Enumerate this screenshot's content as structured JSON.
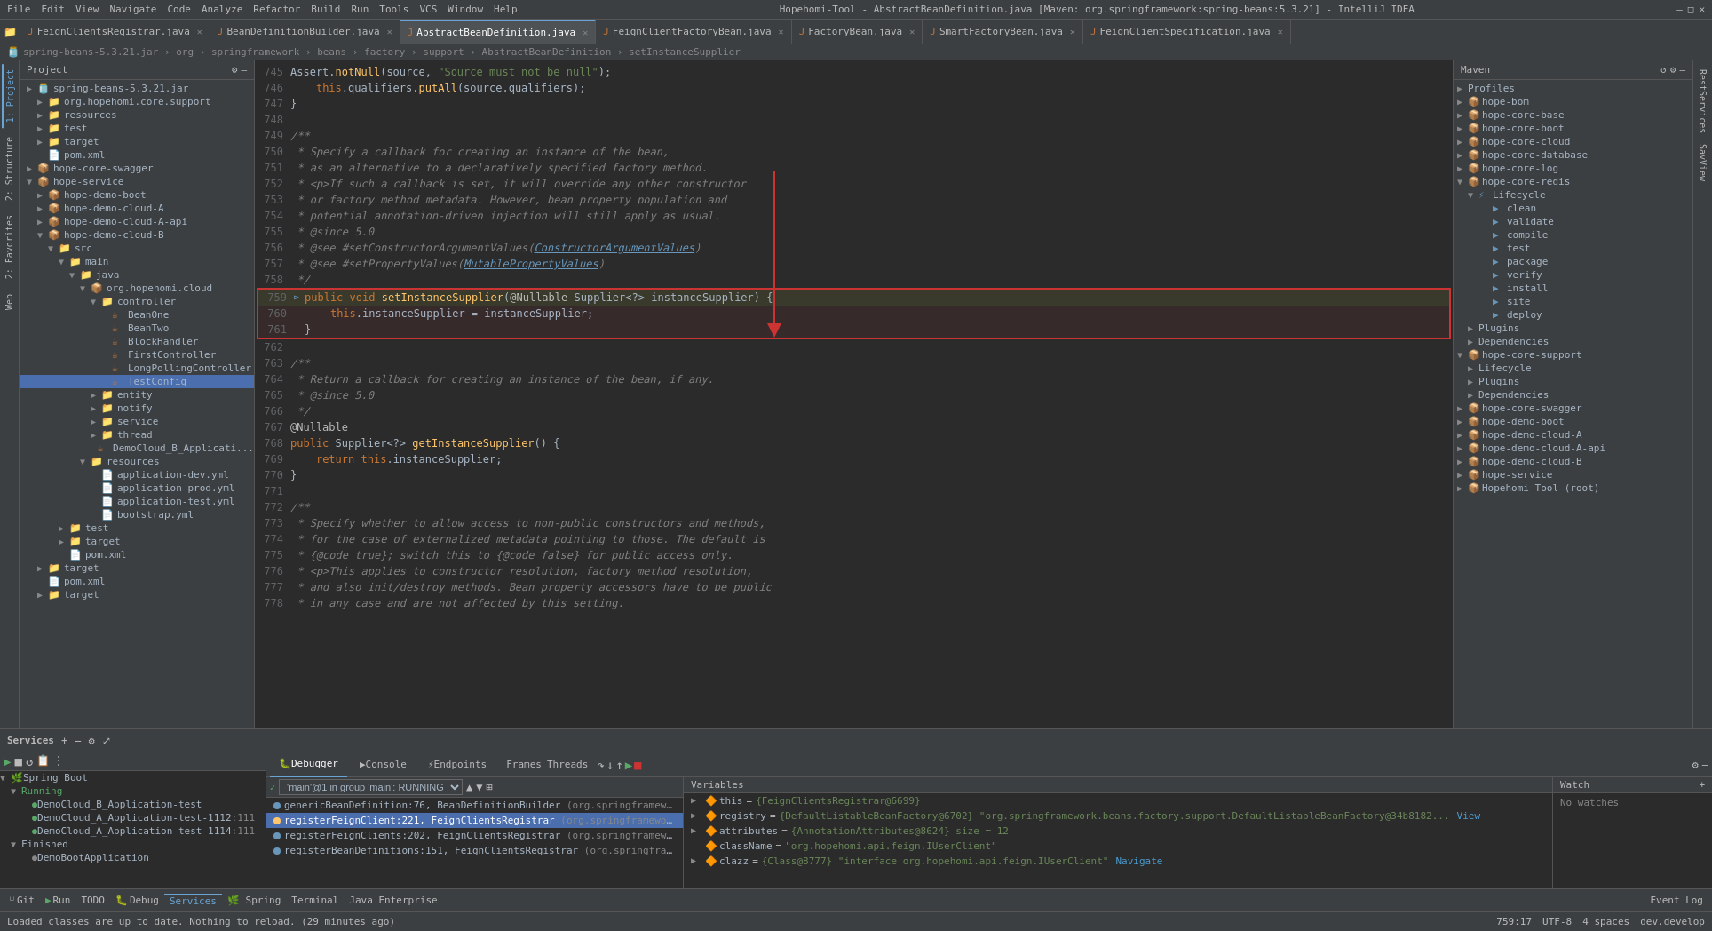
{
  "titlebar": {
    "menu": [
      "File",
      "Edit",
      "View",
      "Navigate",
      "Code",
      "Analyze",
      "Refactor",
      "Build",
      "Run",
      "Tools",
      "VCS",
      "Window",
      "Help"
    ],
    "title": "Hopehomi-Tool - AbstractBeanDefinition.java [Maven: org.springframework:spring-beans:5.3.21] - IntelliJ IDEA",
    "controls": [
      "—",
      "□",
      "✕"
    ]
  },
  "breadcrumb_path": "spring-beans-5.3.21.jar  ›  org  ›  springframework  ›  beans  ›  factory  ›  support  ›  AbstractBeanDefinition  ›  setInstanceSupplier",
  "tabs": [
    {
      "label": "FeignClientsRegistrar.java",
      "active": false,
      "icon": "J"
    },
    {
      "label": "BeanDefinitionBuilder.java",
      "active": false,
      "icon": "J"
    },
    {
      "label": "AbstractBeanDefinition.java",
      "active": true,
      "icon": "J"
    },
    {
      "label": "FeignClientFactoryBean.java",
      "active": false,
      "icon": "J"
    },
    {
      "label": "FactoryBean.java",
      "active": false,
      "icon": "J"
    },
    {
      "label": "SmartFactoryBean.java",
      "active": false,
      "icon": "J"
    },
    {
      "label": "FeignClientSpecification.java",
      "active": false,
      "icon": "J"
    }
  ],
  "code_lines": [
    {
      "num": "745",
      "content": "Assert.notNull(source, \"Source must not be null\");",
      "type": "normal"
    },
    {
      "num": "746",
      "content": "    this.qualifiers.putAll(source.qualifiers);",
      "type": "normal"
    },
    {
      "num": "747",
      "content": "}",
      "type": "normal"
    },
    {
      "num": "748",
      "content": "",
      "type": "normal"
    },
    {
      "num": "749",
      "content": "/**",
      "type": "comment"
    },
    {
      "num": "750",
      "content": " * Specify a callback for creating an instance of the bean,",
      "type": "comment"
    },
    {
      "num": "751",
      "content": " * as an alternative to a declaratively specified factory method.",
      "type": "comment"
    },
    {
      "num": "752",
      "content": " * <p>If such a callback is set, it will override any other constructor",
      "type": "comment"
    },
    {
      "num": "753",
      "content": " * or factory method metadata. However, bean property population and",
      "type": "comment"
    },
    {
      "num": "754",
      "content": " * potential annotation-driven injection will still apply as usual.",
      "type": "comment"
    },
    {
      "num": "755",
      "content": " * @since 5.0",
      "type": "comment"
    },
    {
      "num": "756",
      "content": " * @see #setConstructorArgumentValues(ConstructorArgumentValues)",
      "type": "comment"
    },
    {
      "num": "757",
      "content": " * @see #setPropertyValues(MutablePropertyValues)",
      "type": "comment"
    },
    {
      "num": "758",
      "content": " */",
      "type": "comment"
    },
    {
      "num": "759",
      "content": "public void setInstanceSupplier(@Nullable Supplier<?> instanceSupplier) {",
      "type": "highlighted"
    },
    {
      "num": "760",
      "content": "    this.instanceSupplier = instanceSupplier;",
      "type": "highlighted"
    },
    {
      "num": "761",
      "content": "}",
      "type": "highlighted"
    },
    {
      "num": "762",
      "content": "",
      "type": "normal"
    },
    {
      "num": "763",
      "content": "/**",
      "type": "comment"
    },
    {
      "num": "764",
      "content": " * Return a callback for creating an instance of the bean, if any.",
      "type": "comment"
    },
    {
      "num": "765",
      "content": " * @since 5.0",
      "type": "comment"
    },
    {
      "num": "766",
      "content": " */",
      "type": "comment"
    },
    {
      "num": "767",
      "content": "@Nullable",
      "type": "annotation"
    },
    {
      "num": "768",
      "content": "public Supplier<?> getInstanceSupplier() {",
      "type": "normal"
    },
    {
      "num": "769",
      "content": "    return this.instanceSupplier;",
      "type": "normal"
    },
    {
      "num": "770",
      "content": "}",
      "type": "normal"
    },
    {
      "num": "771",
      "content": "",
      "type": "normal"
    },
    {
      "num": "772",
      "content": "/**",
      "type": "comment"
    },
    {
      "num": "773",
      "content": " * Specify whether to allow access to non-public constructors and methods,",
      "type": "comment"
    },
    {
      "num": "774",
      "content": " * for the case of externalized metadata pointing to those. The default is",
      "type": "comment"
    },
    {
      "num": "775",
      "content": " * {@code true}; switch this to {@code false} for public access only.",
      "type": "comment"
    },
    {
      "num": "776",
      "content": " * <p>This applies to constructor resolution, factory method resolution,",
      "type": "comment"
    },
    {
      "num": "777",
      "content": " * and also init/destroy methods. Bean property accessors have to be public",
      "type": "comment"
    },
    {
      "num": "778",
      "content": " * in any case and are not affected by this setting.",
      "type": "comment"
    }
  ],
  "project": {
    "title": "Project",
    "tree": [
      {
        "label": "org.hopehomi.core.support",
        "depth": 2,
        "type": "package",
        "expanded": false
      },
      {
        "label": "resources",
        "depth": 2,
        "type": "folder",
        "expanded": false
      },
      {
        "label": "test",
        "depth": 2,
        "type": "folder",
        "expanded": false
      },
      {
        "label": "target",
        "depth": 2,
        "type": "folder",
        "expanded": false
      },
      {
        "label": "pom.xml",
        "depth": 2,
        "type": "xml"
      },
      {
        "label": "hope-core-swagger",
        "depth": 1,
        "type": "module",
        "expanded": false
      },
      {
        "label": "hope-service",
        "depth": 1,
        "type": "module",
        "expanded": true
      },
      {
        "label": "hope-demo-boot",
        "depth": 2,
        "type": "module",
        "expanded": false
      },
      {
        "label": "hope-demo-cloud-A",
        "depth": 2,
        "type": "module",
        "expanded": false
      },
      {
        "label": "hope-demo-cloud-A-api",
        "depth": 2,
        "type": "module",
        "expanded": false
      },
      {
        "label": "hope-demo-cloud-B",
        "depth": 2,
        "type": "module",
        "expanded": true
      },
      {
        "label": "src",
        "depth": 3,
        "type": "folder",
        "expanded": true
      },
      {
        "label": "main",
        "depth": 4,
        "type": "folder",
        "expanded": true
      },
      {
        "label": "java",
        "depth": 5,
        "type": "folder",
        "expanded": true
      },
      {
        "label": "org.hopehomi.cloud",
        "depth": 6,
        "type": "package",
        "expanded": true
      },
      {
        "label": "controller",
        "depth": 7,
        "type": "folder",
        "expanded": true
      },
      {
        "label": "BeanOne",
        "depth": 8,
        "type": "java"
      },
      {
        "label": "BeanTwo",
        "depth": 8,
        "type": "java"
      },
      {
        "label": "BlockHandler",
        "depth": 8,
        "type": "java"
      },
      {
        "label": "FirstController",
        "depth": 8,
        "type": "java"
      },
      {
        "label": "LongPollingController",
        "depth": 8,
        "type": "java"
      },
      {
        "label": "TestConfig",
        "depth": 8,
        "type": "java",
        "selected": true
      },
      {
        "label": "entity",
        "depth": 7,
        "type": "folder",
        "expanded": false
      },
      {
        "label": "notify",
        "depth": 7,
        "type": "folder",
        "expanded": false
      },
      {
        "label": "service",
        "depth": 7,
        "type": "folder",
        "expanded": false
      },
      {
        "label": "thread",
        "depth": 7,
        "type": "folder",
        "expanded": false
      },
      {
        "label": "DemoCloud_B_Applicati...",
        "depth": 7,
        "type": "java"
      },
      {
        "label": "resources",
        "depth": 6,
        "type": "folder",
        "expanded": true
      },
      {
        "label": "application-dev.yml",
        "depth": 7,
        "type": "yml"
      },
      {
        "label": "application-prod.yml",
        "depth": 7,
        "type": "yml"
      },
      {
        "label": "application-test.yml",
        "depth": 7,
        "type": "yml"
      },
      {
        "label": "bootstrap.yml",
        "depth": 7,
        "type": "yml"
      },
      {
        "label": "test",
        "depth": 5,
        "type": "folder",
        "expanded": false
      },
      {
        "label": "target",
        "depth": 5,
        "type": "folder",
        "expanded": false
      },
      {
        "label": "pom.xml",
        "depth": 5,
        "type": "xml"
      },
      {
        "label": "target",
        "depth": 5,
        "type": "folder",
        "expanded": false
      }
    ]
  },
  "maven": {
    "title": "Maven",
    "profiles_label": "Profiles",
    "items": [
      {
        "label": "hope-bom",
        "depth": 1,
        "type": "module",
        "expanded": false
      },
      {
        "label": "hope-core-base",
        "depth": 1,
        "type": "module",
        "expanded": false
      },
      {
        "label": "hope-core-boot",
        "depth": 1,
        "type": "module",
        "expanded": false
      },
      {
        "label": "hope-core-cloud",
        "depth": 1,
        "type": "module",
        "expanded": false
      },
      {
        "label": "hope-core-database",
        "depth": 1,
        "type": "module",
        "expanded": false
      },
      {
        "label": "hope-core-log",
        "depth": 1,
        "type": "module",
        "expanded": false
      },
      {
        "label": "hope-core-redis",
        "depth": 1,
        "type": "module",
        "expanded": true
      },
      {
        "label": "Lifecycle",
        "depth": 2,
        "type": "lifecycle",
        "expanded": true
      },
      {
        "label": "clean",
        "depth": 3,
        "type": "goal"
      },
      {
        "label": "validate",
        "depth": 3,
        "type": "goal"
      },
      {
        "label": "compile",
        "depth": 3,
        "type": "goal"
      },
      {
        "label": "test",
        "depth": 3,
        "type": "goal"
      },
      {
        "label": "package",
        "depth": 3,
        "type": "goal"
      },
      {
        "label": "verify",
        "depth": 3,
        "type": "goal"
      },
      {
        "label": "install",
        "depth": 3,
        "type": "goal"
      },
      {
        "label": "site",
        "depth": 3,
        "type": "goal"
      },
      {
        "label": "deploy",
        "depth": 3,
        "type": "goal"
      },
      {
        "label": "Plugins",
        "depth": 2,
        "type": "lifecycle",
        "expanded": false
      },
      {
        "label": "Dependencies",
        "depth": 2,
        "type": "lifecycle",
        "expanded": false
      },
      {
        "label": "hope-core-support",
        "depth": 1,
        "type": "module",
        "expanded": true
      },
      {
        "label": "Lifecycle",
        "depth": 2,
        "type": "lifecycle",
        "expanded": false
      },
      {
        "label": "Plugins",
        "depth": 2,
        "type": "lifecycle",
        "expanded": false
      },
      {
        "label": "Dependencies",
        "depth": 2,
        "type": "lifecycle",
        "expanded": false
      },
      {
        "label": "hope-core-swagger",
        "depth": 1,
        "type": "module",
        "expanded": false
      },
      {
        "label": "hope-demo-boot",
        "depth": 1,
        "type": "module",
        "expanded": false
      },
      {
        "label": "hope-demo-cloud-A",
        "depth": 1,
        "type": "module",
        "expanded": false
      },
      {
        "label": "hope-demo-cloud-A-api",
        "depth": 1,
        "type": "module",
        "expanded": false
      },
      {
        "label": "hope-demo-cloud-B",
        "depth": 1,
        "type": "module",
        "expanded": false
      },
      {
        "label": "hope-service",
        "depth": 1,
        "type": "module",
        "expanded": false
      },
      {
        "label": "Hopehomi-Tool (root)",
        "depth": 1,
        "type": "module",
        "expanded": false
      }
    ]
  },
  "services": {
    "title": "Services",
    "spring_boot_label": "Spring Boot",
    "running_label": "Running",
    "finished_label": "Finished",
    "apps": [
      {
        "label": "DemoCloud_B_Application-test",
        "status": "running",
        "port": ""
      },
      {
        "label": "DemoCloud_A_Application-test-1112",
        "status": "running",
        "port": ":111"
      },
      {
        "label": "DemoCloud_A_Application-test-1114",
        "status": "running",
        "port": ":111"
      },
      {
        "label": "DemoBootApplication",
        "status": "finished"
      }
    ]
  },
  "debugger": {
    "tabs": [
      "Debugger",
      "Console",
      "Endpoints"
    ],
    "frames_label": "Frames",
    "threads_label": "Threads",
    "variables_label": "Variables",
    "thread_selector": "'main'@1 in group 'main': RUNNING",
    "frames": [
      {
        "method": "genericBeanDefinition:76, BeanDefinitionBuilder",
        "package": "(org.springframework.beans.factory.support)",
        "selected": false
      },
      {
        "method": "registerFeignClient:221, FeignClientsRegistrar",
        "package": "(org.springframework.cloud.openfeign)",
        "selected": true
      },
      {
        "method": "registerFeignClients:202, FeignClientsRegistrar",
        "package": "(org.springframework.cloud.openfeign)",
        "selected": false
      },
      {
        "method": "registerBeanDefinitions:151, FeignClientsRegistrar",
        "package": "(org.springframework.cloud.openfeign)",
        "selected": false
      }
    ],
    "variables": [
      {
        "name": "this",
        "value": "= {FeignClientsRegistrar@6699}"
      },
      {
        "name": "registry",
        "value": "= {DefaultListableBeanFactory@6702} \"org.springframework.beans.factory.support.DefaultListableBeanFactory@34b8182..."
      },
      {
        "name": "attributes",
        "value": "= {AnnotationAttributes@8624} size = 12"
      },
      {
        "name": "className",
        "value": "= \"org.hopehomi.api.feign.IUserClient\""
      },
      {
        "name": "clazz",
        "value": "= {Class@8777} \"interface org.hopehomi.api.feign.IUserClient\""
      }
    ],
    "watch_label": "Watch",
    "no_watches": "No watches"
  },
  "statusbar": {
    "message": "Loaded classes are up to date. Nothing to reload. (29 minutes ago)",
    "position": "759:17",
    "encoding": "UTF-8",
    "spaces": "4 spaces",
    "branch": "dev.develop"
  },
  "bottom_toolbar": {
    "git_label": "Git",
    "run_label": "Run",
    "todo_label": "TODO",
    "debug_label": "Debug",
    "services_label": "Services",
    "spring_label": "Spring",
    "terminal_label": "Terminal",
    "java_enterprise_label": "Java Enterprise",
    "event_log_label": "Event Log"
  },
  "run_config": "DemoCloud_B_Application-test"
}
